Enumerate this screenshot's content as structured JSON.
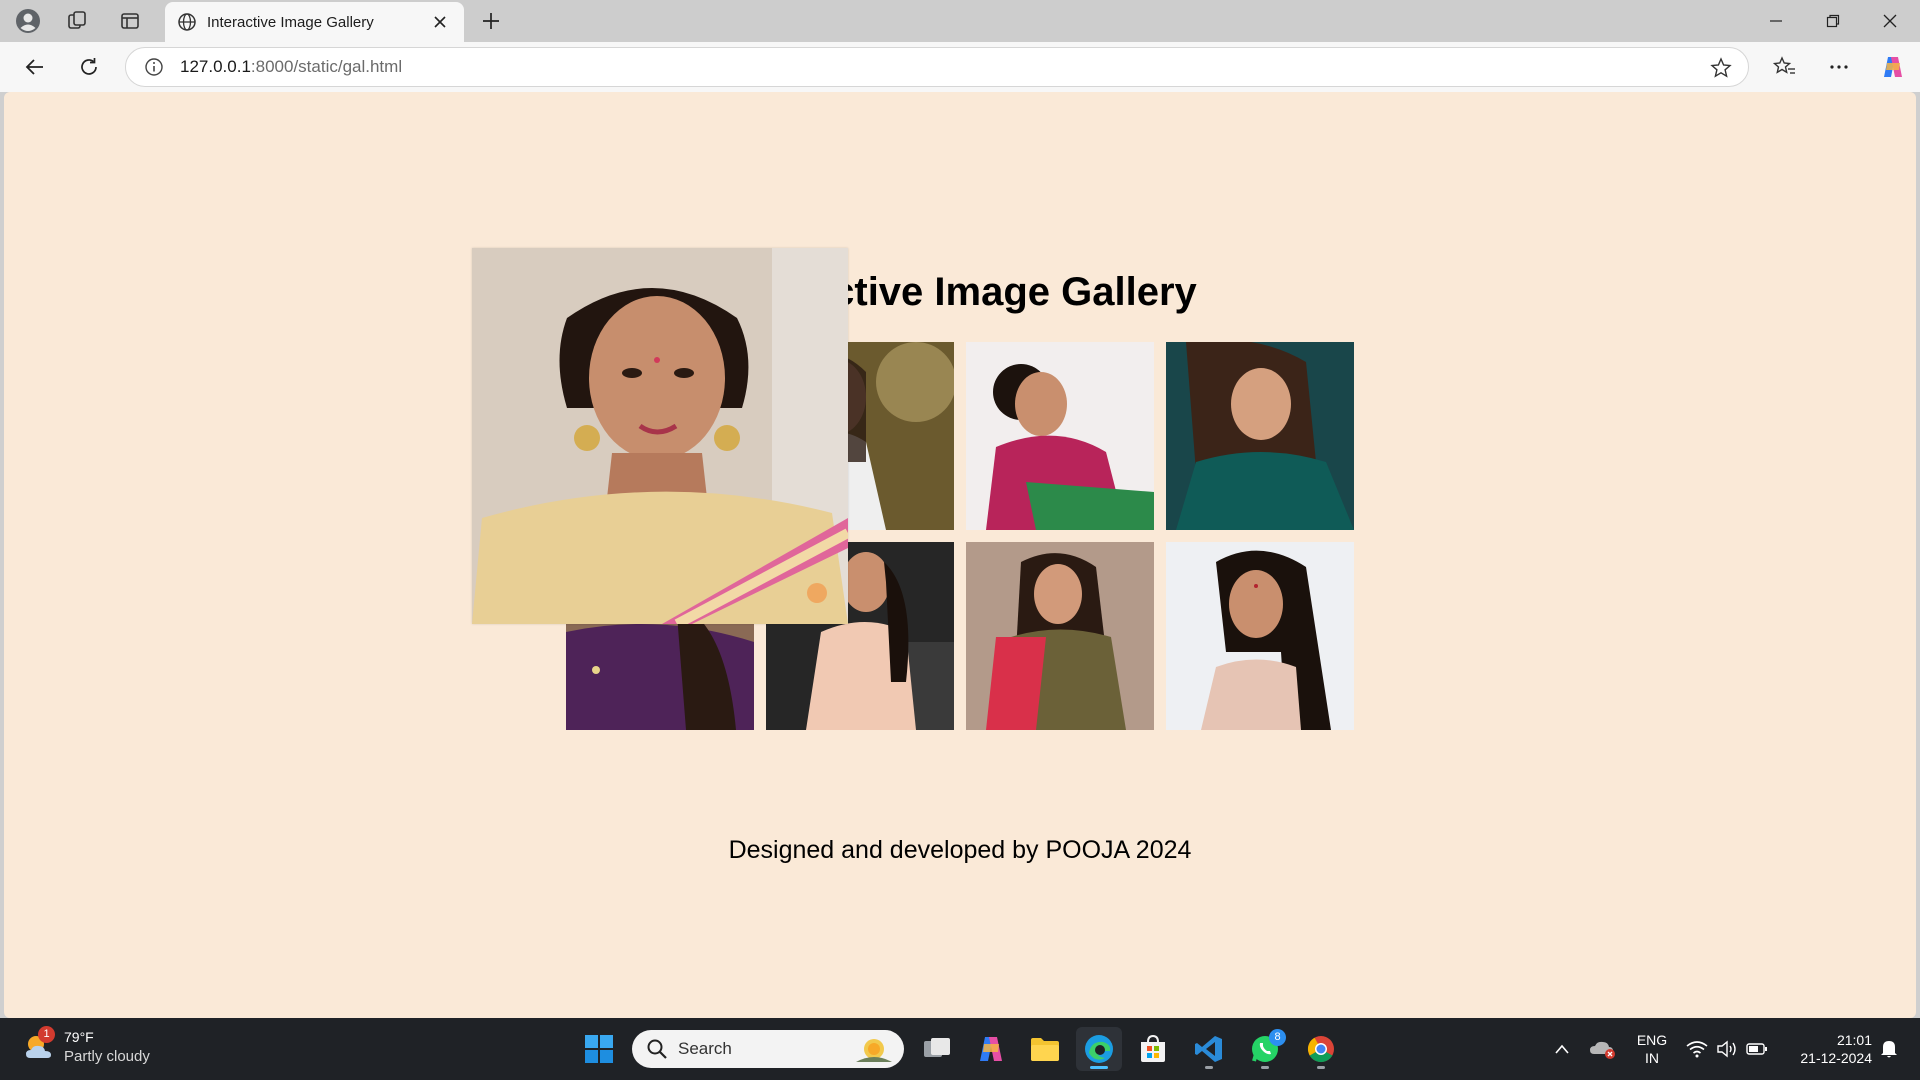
{
  "browser": {
    "tab_title": "Interactive Image Gallery",
    "url_host": "127.0.0.1",
    "url_rest": ":8000/static/gal.html"
  },
  "page": {
    "heading": "Interactive Image Gallery",
    "footer": "Designed and developed by POOJA 2024",
    "background": "#fae9d7"
  },
  "gallery": {
    "columns": 4,
    "rows": 2,
    "hovered_index": 0
  },
  "taskbar": {
    "weather_temp": "79°F",
    "weather_desc": "Partly cloudy",
    "weather_badge": "1",
    "search_placeholder": "Search",
    "whatsapp_badge": "8",
    "lang_top": "ENG",
    "lang_bottom": "IN",
    "time": "21:01",
    "date": "21-12-2024"
  }
}
